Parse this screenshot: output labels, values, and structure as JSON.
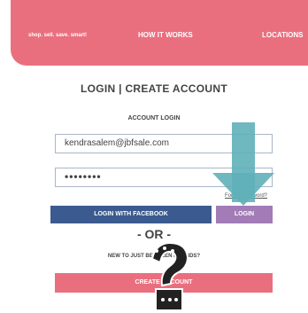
{
  "nav": {
    "tagline": "shop. sell. save. smart!",
    "how_it_works": "HOW IT WORKS",
    "locations": "LOCATIONS"
  },
  "page": {
    "heading": "LOGIN | CREATE ACCOUNT",
    "account_login": "ACCOUNT LOGIN"
  },
  "form": {
    "email_value": "kendrasalem@jbfsale.com",
    "password_value": "••••••••",
    "forgot_password": "Forgot password?",
    "facebook_button": "LOGIN WITH FACEBOOK",
    "login_button": "LOGIN"
  },
  "divider": "- OR -",
  "new_user": {
    "prompt": "NEW TO JUST BETWEEN FRIENDS?",
    "create_button": "CREATE ACCOUNT"
  },
  "colors": {
    "brand_pink": "#ea6f7e",
    "facebook_blue": "#3b5a8f",
    "login_purple": "#a27bb7",
    "arrow_teal": "#5fb0b9"
  },
  "overlays": {
    "arrow": "teal-down-arrow",
    "cursor": "question-mark-cursor-icon"
  }
}
